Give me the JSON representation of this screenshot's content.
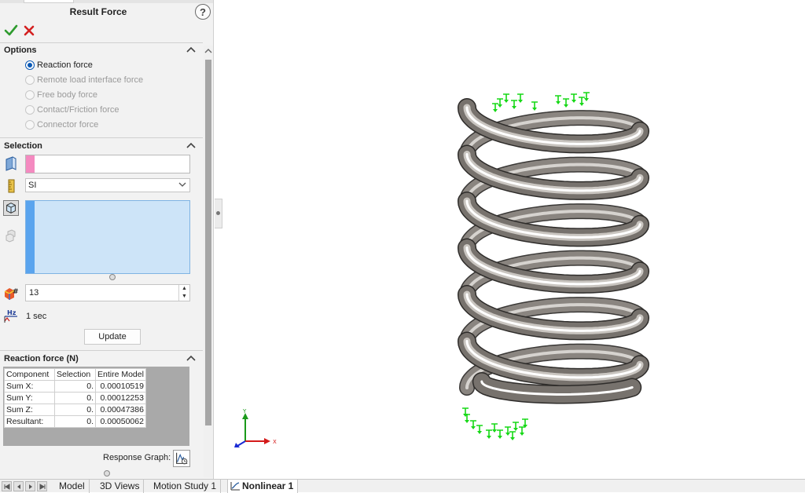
{
  "property_manager": {
    "title": "Result Force",
    "help_symbol": "?"
  },
  "options": {
    "header": "Options",
    "radios": [
      {
        "label": "Reaction force",
        "selected": true
      },
      {
        "label": "Remote load interface force",
        "selected": false
      },
      {
        "label": "Free body force",
        "selected": false
      },
      {
        "label": "Contact/Friction force",
        "selected": false
      },
      {
        "label": "Connector force",
        "selected": false
      }
    ]
  },
  "selection": {
    "header": "Selection",
    "units": "SI",
    "step_number": "13",
    "time": "1 sec",
    "update_label": "Update",
    "frequency_icon_text": "Hz"
  },
  "reaction": {
    "header": "Reaction force (N)",
    "columns": [
      "Component",
      "Selection",
      "Entire Model"
    ],
    "rows": [
      [
        "Sum X:",
        "0.",
        "0.00010519"
      ],
      [
        "Sum Y:",
        "0.",
        "0.00012253"
      ],
      [
        "Sum Z:",
        "0.",
        "0.00047386"
      ],
      [
        "Resultant:",
        "0.",
        "0.00050062"
      ]
    ],
    "response_graph_label": "Response Graph:"
  },
  "triad": {
    "y": "Y",
    "x": "X"
  },
  "tabs": {
    "items": [
      {
        "label": "Model",
        "active": false
      },
      {
        "label": "3D Views",
        "active": false
      },
      {
        "label": "Motion Study 1",
        "active": false
      },
      {
        "label": "Nonlinear 1",
        "active": true
      }
    ]
  },
  "colors": {
    "ok_green": "#2e9b2e",
    "cancel_red": "#d42020",
    "fixture_green": "#16d816",
    "selection_blue": "#cde4f8"
  },
  "icons": [
    "check-icon",
    "close-icon",
    "help-icon",
    "face-icon",
    "units-icon",
    "component-cube-icon",
    "multi-body-icon",
    "plot-step-icon",
    "frequency-icon",
    "response-graph-icon"
  ]
}
